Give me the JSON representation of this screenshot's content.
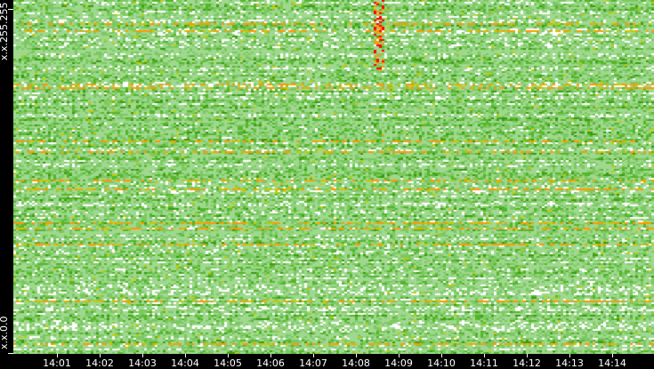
{
  "chart_data": {
    "type": "heatmap",
    "title": "",
    "xlabel": "",
    "ylabel": "",
    "x_tick_labels": [
      "14:01",
      "14:02",
      "14:03",
      "14:04",
      "14:05",
      "14:06",
      "14:07",
      "14:08",
      "14:09",
      "14:10",
      "14:11",
      "14:12",
      "14:13",
      "14:14"
    ],
    "y_tick_labels": {
      "top": "x.x.255.255",
      "bottom": "x.x.0.0"
    },
    "color_scale": [
      "#ffffff",
      "#9fd88f",
      "#7cc862",
      "#55b52a",
      "#3a9a10",
      "#c8c800",
      "#ff9900",
      "#ff0000"
    ],
    "notable_events": [
      {
        "time": "14:08.5",
        "rows": "top",
        "level": "high"
      }
    ]
  }
}
